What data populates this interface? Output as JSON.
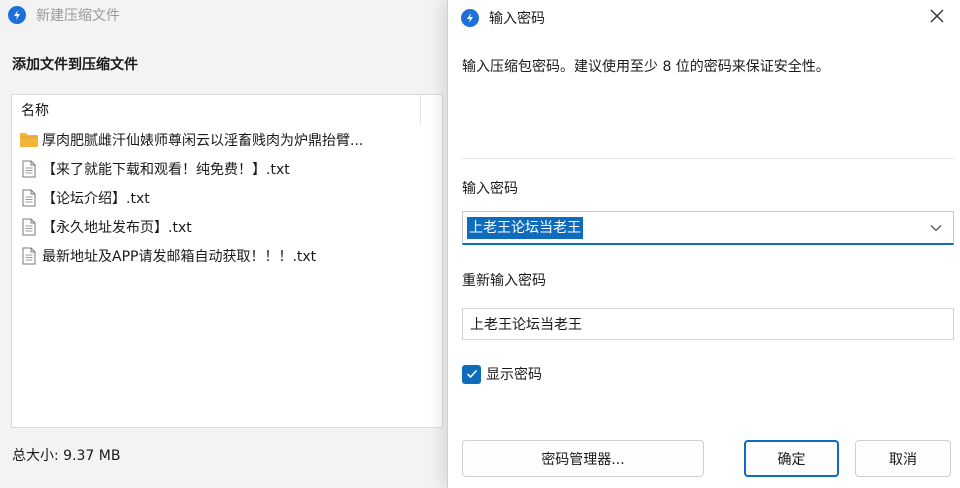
{
  "background_window": {
    "title": "新建压缩文件",
    "heading": "添加文件到压缩文件",
    "list": {
      "column_name": "名称",
      "items": [
        {
          "type": "folder",
          "name": "厚肉肥腻雌汗仙婊师尊闲云以淫畜贱肉为炉鼎抬臂..."
        },
        {
          "type": "file",
          "name": "【来了就能下载和观看！纯免费！】.txt"
        },
        {
          "type": "file",
          "name": "【论坛介绍】.txt"
        },
        {
          "type": "file",
          "name": "【永久地址发布页】.txt"
        },
        {
          "type": "file",
          "name": "最新地址及APP请发邮箱自动获取！！！.txt"
        }
      ]
    },
    "total_size": "总大小: 9.37 MB"
  },
  "dialog": {
    "title": "输入密码",
    "description": "输入压缩包密码。建议使用至少 8 位的密码来保证安全性。",
    "password_label": "输入密码",
    "password_value": "上老王论坛当老王",
    "reenter_label": "重新输入密码",
    "reenter_value": "上老王论坛当老王",
    "show_password_label": "显示密码",
    "show_password_checked": true,
    "buttons": {
      "manager": "密码管理器...",
      "ok": "确定",
      "cancel": "取消"
    }
  },
  "colors": {
    "accent": "#0f6cbd",
    "folder": "#f2b53a",
    "app_icon": "#1f6fd8"
  },
  "icons": {
    "app": "app-logo-icon",
    "close": "close-icon",
    "dropdown": "chevron-down-icon",
    "folder": "folder-icon",
    "file": "text-file-icon",
    "checkbox": "checkmark-icon"
  }
}
